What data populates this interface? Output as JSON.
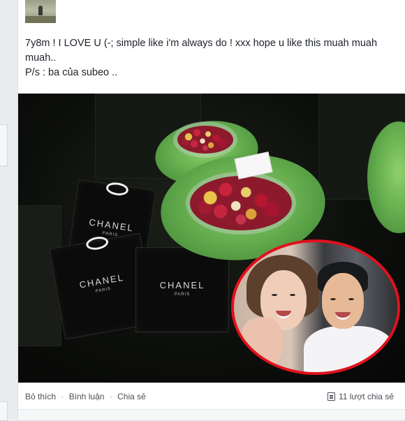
{
  "post": {
    "text_line1": "7y8m ! I LOVE U (-; simple like i'm always do ! xxx hope u like this muah muah muah..",
    "text_line2": "P/s : ba của subeo .."
  },
  "photo": {
    "bags": [
      {
        "brand": "CHANEL",
        "sub": "PARIS"
      },
      {
        "brand": "CHANEL",
        "sub": "PARIS"
      },
      {
        "brand": "CHANEL",
        "sub": "PARIS"
      }
    ]
  },
  "actions": {
    "like": "Bỏ thích",
    "comment": "Bình luận",
    "share": "Chia sẻ",
    "sep": "·",
    "share_count": "11 lượt chia sẻ"
  },
  "colors": {
    "text": "#1d2129",
    "meta": "#4b4f56",
    "inset_border": "#e1111c",
    "background": "#e9ebee"
  },
  "icons": {
    "share_count": "share-count-icon"
  }
}
